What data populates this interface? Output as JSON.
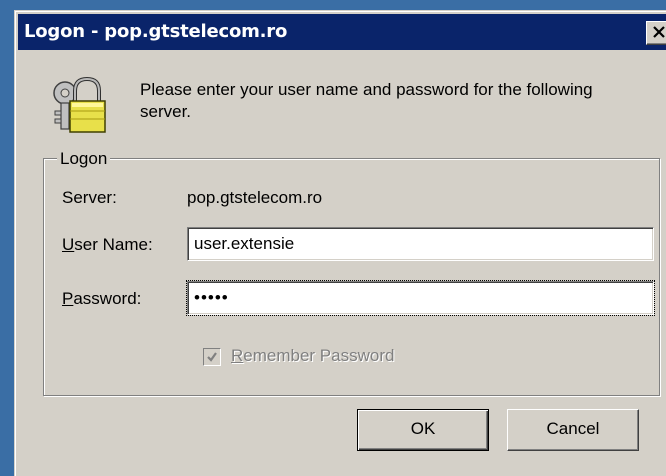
{
  "window": {
    "title": "Logon - pop.gtstelecom.ro",
    "close_icon": "close-icon"
  },
  "dialog": {
    "icon": "lock-keys-icon",
    "prompt": "Please enter your user name and password for the following server."
  },
  "logon_group": {
    "legend": "Logon",
    "server_label": "Server:",
    "server_value": "pop.gtstelecom.ro",
    "username_label_accel": "U",
    "username_label_rest": "ser Name:",
    "username_value": "user.extensie",
    "password_label_accel": "P",
    "password_label_rest": "assword:",
    "password_value": "•••••",
    "remember_label_accel": "R",
    "remember_label_rest": "emember Password",
    "remember_checked": true,
    "remember_disabled": true
  },
  "buttons": {
    "ok": "OK",
    "cancel": "Cancel"
  },
  "colors": {
    "titlebar": "#0a246a",
    "face": "#d4d0c8",
    "desktop": "#3a6ea5"
  }
}
